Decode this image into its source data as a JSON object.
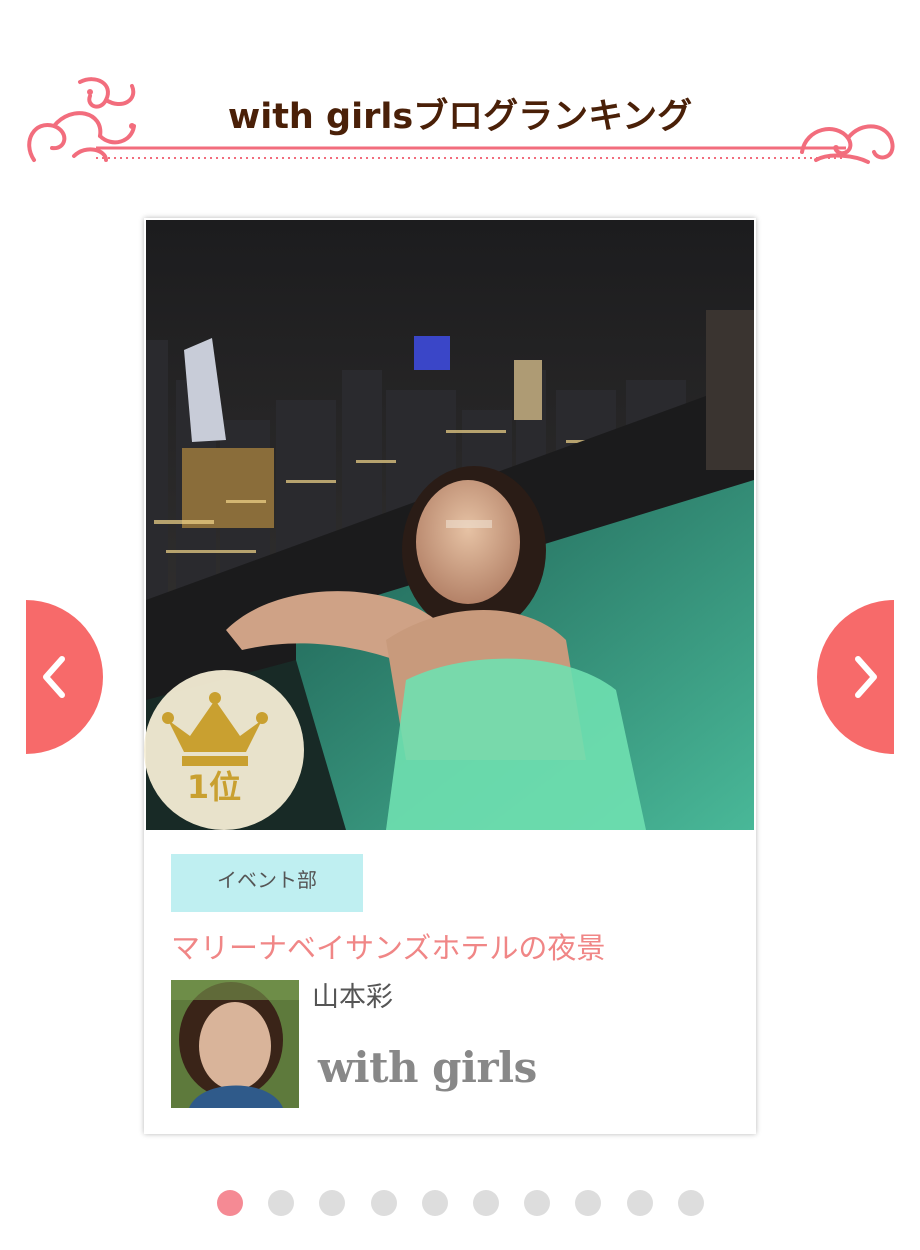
{
  "header": {
    "title": "with girlsブログランキング",
    "accent_color": "#f26d7d"
  },
  "card": {
    "rank_label": "1位",
    "rank_icon": "crown-icon",
    "category_tag": "イベント部",
    "post_title": "マリーナベイサンズホテルの夜景",
    "author_name": "山本彩",
    "brand_logo": "with girls"
  },
  "nav": {
    "prev_icon": "chevron-left-icon",
    "next_icon": "chevron-right-icon",
    "button_color": "#f76a6a"
  },
  "pagination": {
    "total": 10,
    "active_index": 0,
    "active_color": "#f58a94",
    "inactive_color": "#dddddd"
  },
  "colors": {
    "title_text": "#4a2008",
    "post_title": "#f08686",
    "tag_bg": "#bfeff1",
    "badge_gold": "#c9a030"
  }
}
